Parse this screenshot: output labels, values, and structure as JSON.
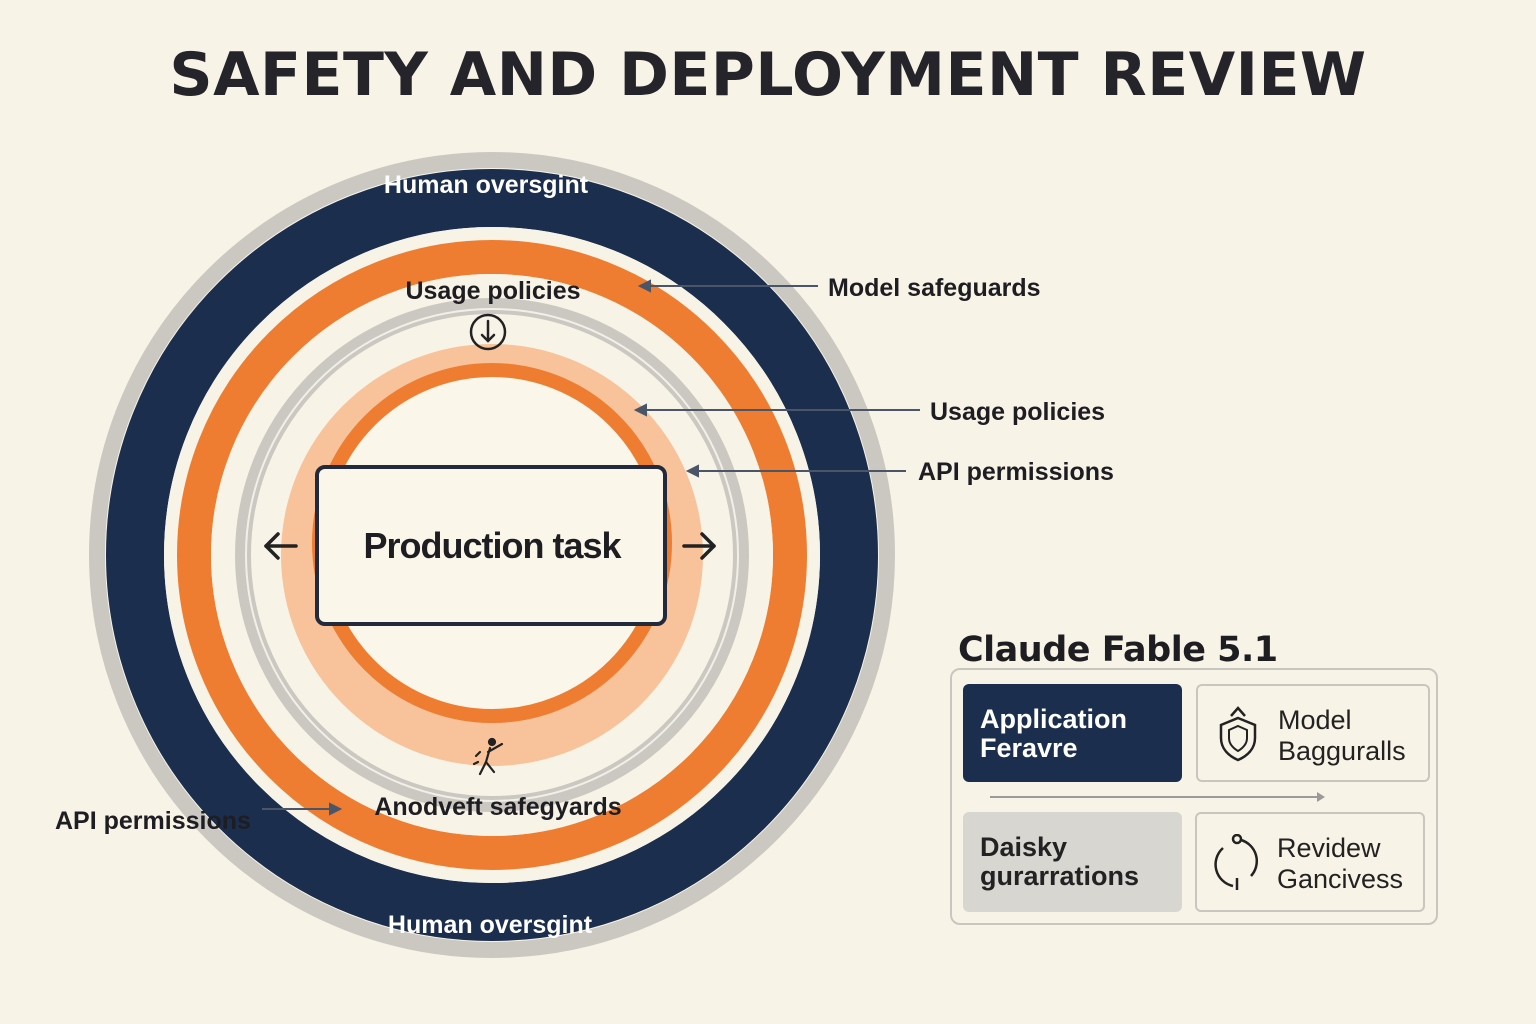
{
  "title": "SAFETY AND DEPLOYMENT REVIEW",
  "rings": {
    "outer_top_label": "Human oversgint",
    "outer_bottom_label": "Human oversgint",
    "inner_top_label": "Usage policies",
    "inner_bottom_label": "Anodveft safegyards",
    "center_label": "Production task"
  },
  "callouts": {
    "model_safeguards": "Model safeguards",
    "usage_policies": "Usage policies",
    "api_permissions_right": "API permissions",
    "api_permissions_left": "API permissions"
  },
  "panel": {
    "title": "Claude Fable 5.1",
    "application": {
      "line1": "Application",
      "line2": "Feravre"
    },
    "model": {
      "line1": "Model",
      "line2": "Bagguralls",
      "icon": "shield-icon"
    },
    "daisky": {
      "line1": "Daisky",
      "line2": "gurarrations"
    },
    "review": {
      "line1": "Revidew",
      "line2": "Gancivess",
      "icon": "cycle-icon"
    }
  },
  "colors": {
    "navy": "#1c2e4e",
    "orange": "#ee7d31",
    "peach": "#f8c39a",
    "grey": "#cbc8c2",
    "background": "#f8f3e7"
  }
}
